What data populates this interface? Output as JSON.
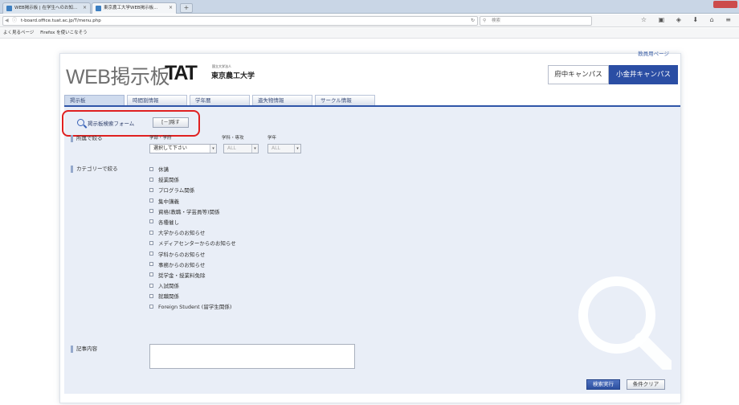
{
  "browser": {
    "tabs": [
      {
        "title": "WEB掲示板 | 在学生へのお知..."
      },
      {
        "title": "東京農工大学WEB掲示板..."
      }
    ],
    "url": "t-board.office.tuat.ac.jp/T/menu.php",
    "search_placeholder": "検索",
    "bookmarks": [
      "よく見るページ",
      "Firefox を使いこなそう"
    ]
  },
  "header": {
    "staff_link": "教員用ページ",
    "logo_web": "WEB掲示板",
    "logo_tat": "TAT",
    "logo_univ_small": "国立大学法人",
    "logo_univ": "東京農工大学",
    "campus": [
      "府中キャンパス",
      "小金井キャンパス"
    ]
  },
  "tabs": [
    "掲示板",
    "時間割情報",
    "学年暦",
    "遺失物情報",
    "サークル情報"
  ],
  "search_form": {
    "title": "掲示板検索フォーム",
    "hide_label": "[－]隠す"
  },
  "filters": {
    "affiliation_label": "所属で絞る",
    "faculty_label": "学部・学府",
    "dept_label": "学科・専攻",
    "year_label": "学年",
    "faculty_value": "選択して下さい",
    "dept_value": "ALL",
    "year_value": "ALL"
  },
  "categories": {
    "label": "カテゴリーで絞る",
    "items": [
      "休講",
      "授業関係",
      "プログラム関係",
      "集中講義",
      "資格(教職・学芸員等)関係",
      "各種催し",
      "大学からのお知らせ",
      "メディアセンターからのお知らせ",
      "学科からのお知らせ",
      "事務からのお知らせ",
      "奨学金・授業料免除",
      "入試関係",
      "就職関係",
      "Foreign Student (留学生関係)"
    ]
  },
  "article": {
    "label": "記事内容"
  },
  "actions": {
    "exec": "検索実行",
    "clear": "条件クリア"
  }
}
